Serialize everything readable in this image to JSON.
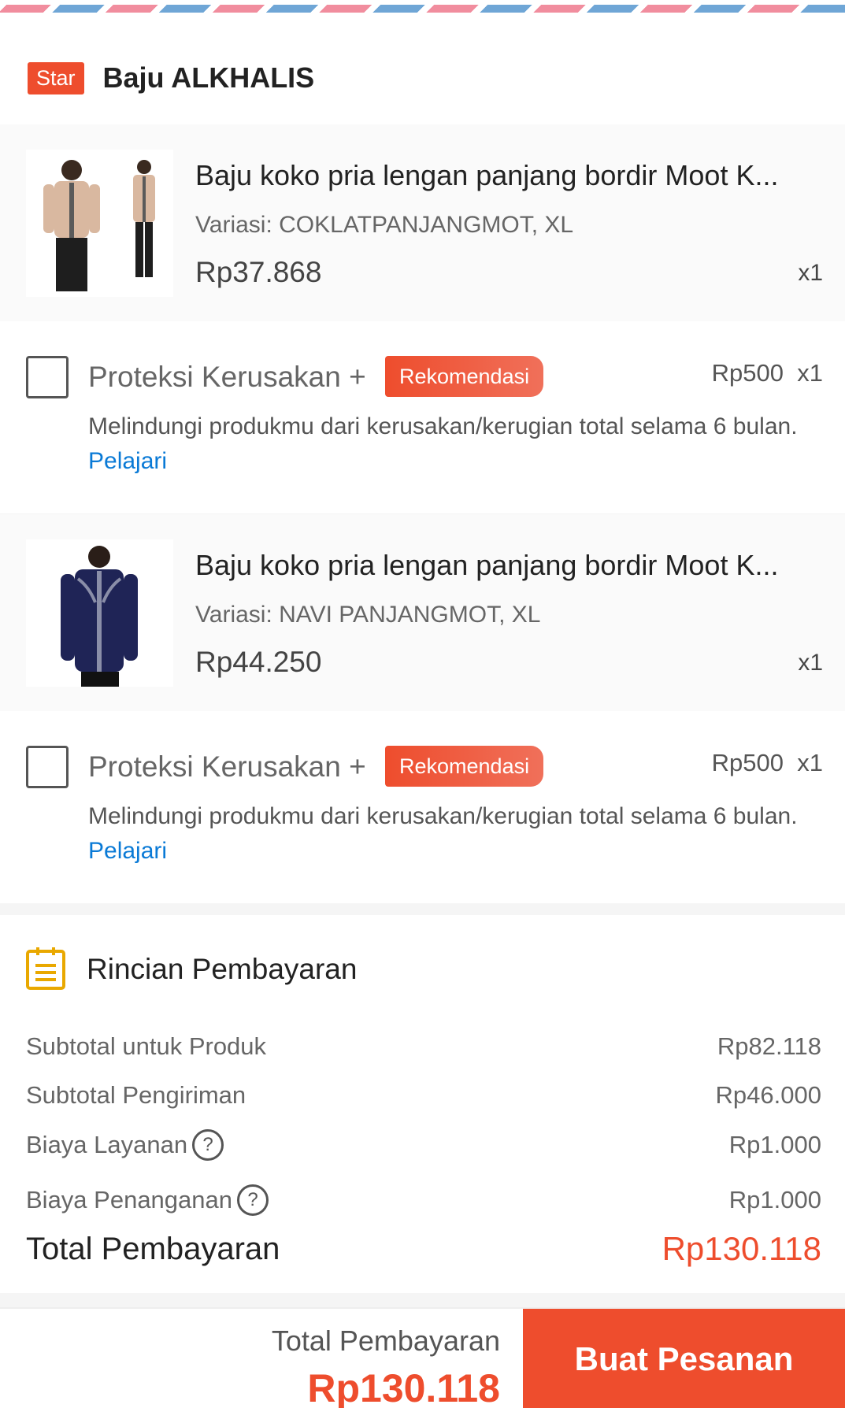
{
  "shop": {
    "badge": "Star",
    "name": "Baju ALKHALIS"
  },
  "products": [
    {
      "title": "Baju koko pria lengan panjang  bordir Moot K...",
      "variant": "Variasi: COKLATPANJANGMOT, XL",
      "price": "Rp37.868",
      "qty": "x1",
      "shirt_color": "#d9b8a0"
    },
    {
      "title": "Baju koko pria lengan panjang  bordir Moot K...",
      "variant": "Variasi: NAVI PANJANGMOT, XL",
      "price": "Rp44.250",
      "qty": "x1",
      "shirt_color": "#1f2456"
    }
  ],
  "protection": [
    {
      "title": "Proteksi Kerusakan +",
      "badge": "Rekomendasi",
      "price": "Rp500  x1",
      "desc": "Melindungi produkmu dari kerusakan/kerugian total selama 6 bulan.",
      "link": "Pelajari"
    },
    {
      "title": "Proteksi Kerusakan +",
      "badge": "Rekomendasi",
      "price": "Rp500  x1",
      "desc": "Melindungi produkmu dari kerusakan/kerugian total selama 6 bulan.",
      "link": "Pelajari"
    }
  ],
  "payment": {
    "title": "Rincian Pembayaran",
    "rows": [
      {
        "label": "Subtotal untuk Produk",
        "value": "Rp82.118"
      },
      {
        "label": "Subtotal Pengiriman",
        "value": "Rp46.000"
      },
      {
        "label": "Biaya Layanan",
        "value": "Rp1.000"
      },
      {
        "label": "Biaya Penanganan",
        "value": "Rp1.000"
      }
    ],
    "help_glyph": "?",
    "total_label": "Total Pembayaran",
    "total_value": "Rp130.118"
  },
  "bottom": {
    "total_label": "Total Pembayaran",
    "total_value": "Rp130.118",
    "button_label": "Buat Pesanan"
  },
  "colors": {
    "accent": "#ee4d2d",
    "link": "#0a7ad6",
    "icon": "#e9a800"
  }
}
